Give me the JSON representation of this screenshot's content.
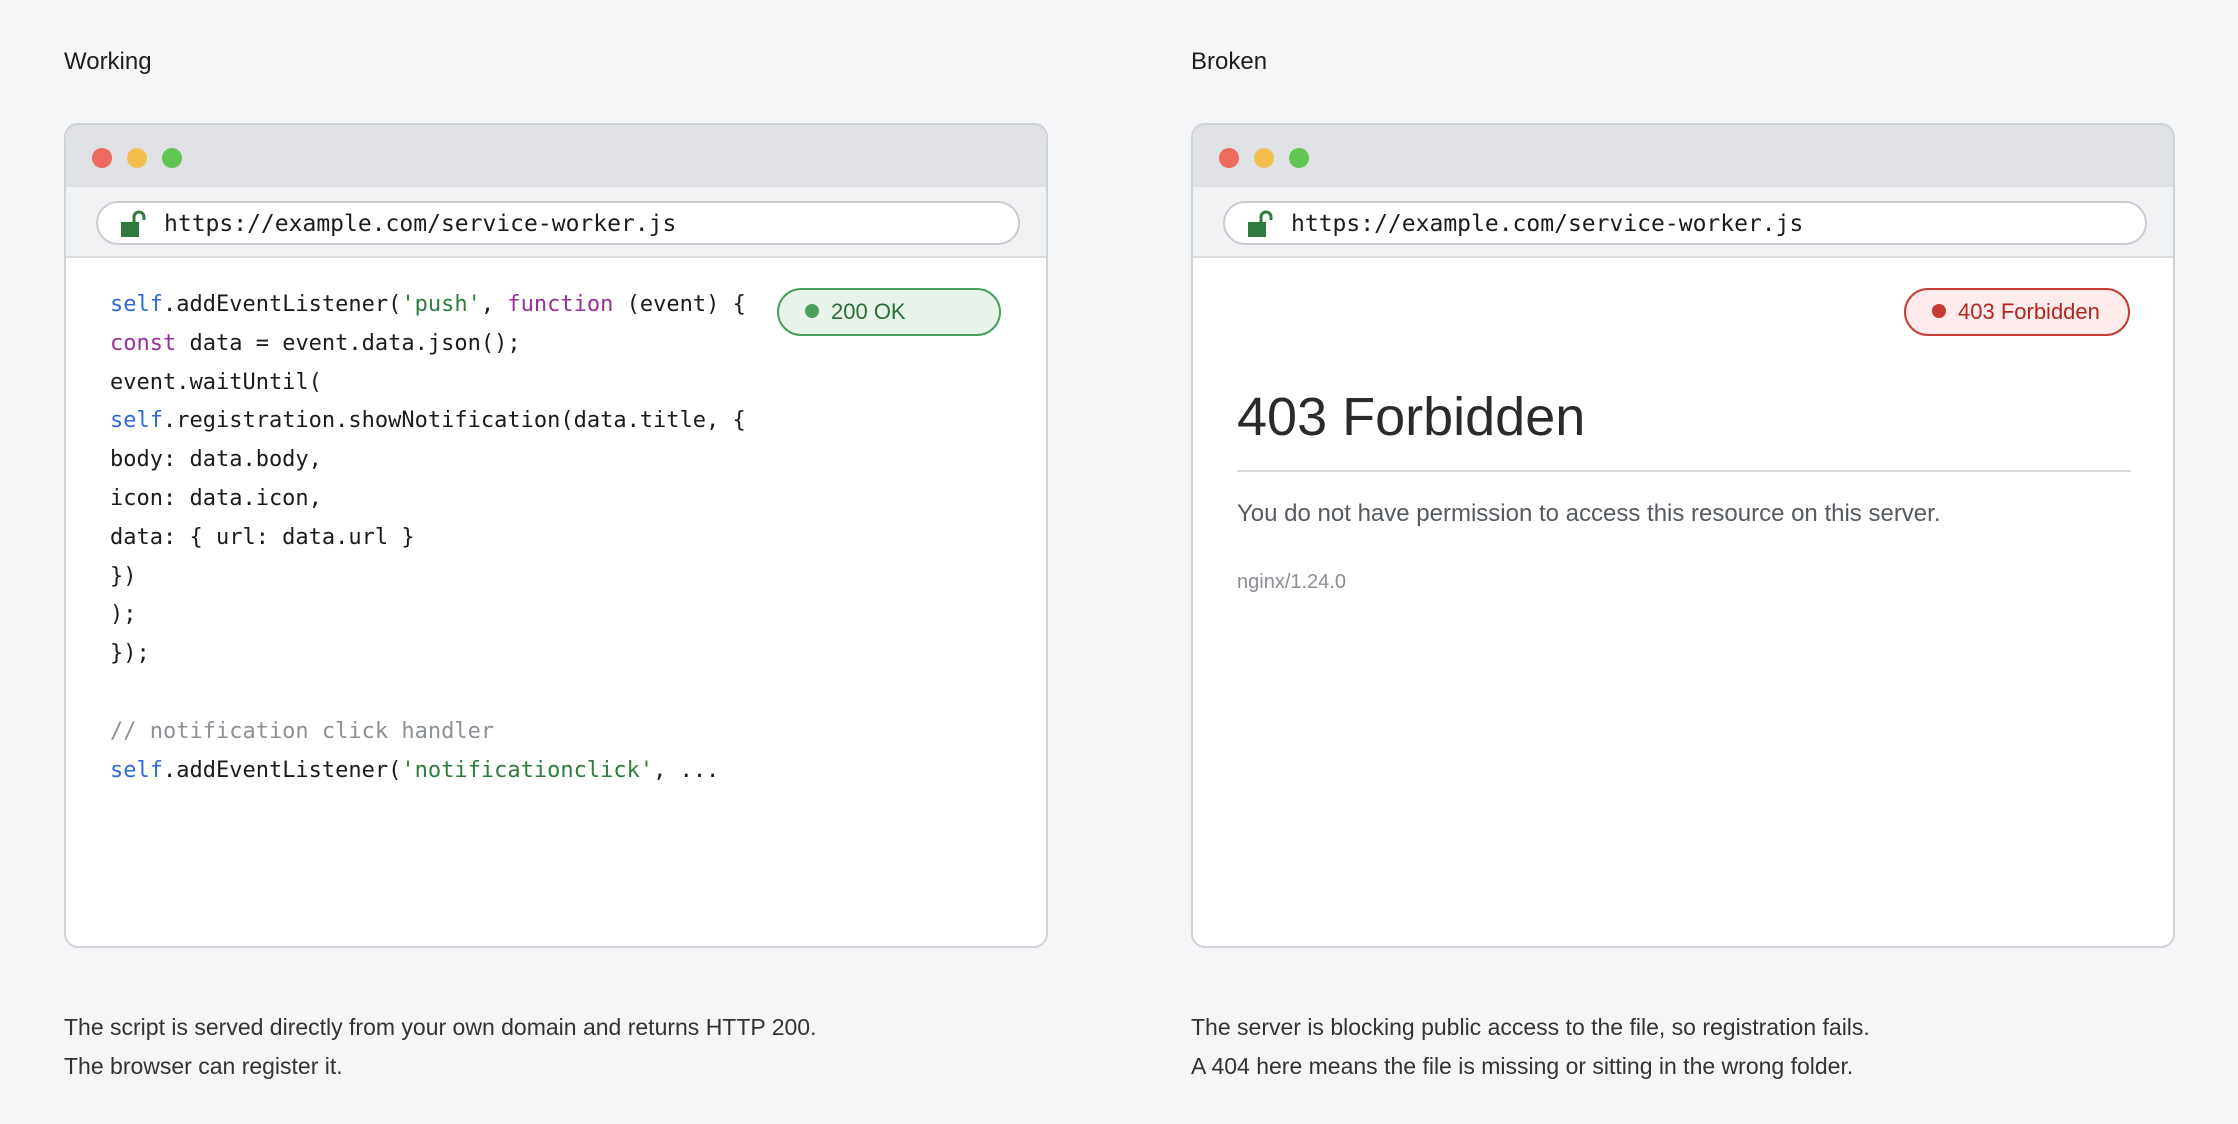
{
  "panels": [
    {
      "title": "Working",
      "url": "https://example.com/service-worker.js",
      "status_badge": "200 OK",
      "code_lines": [
        [
          [
            "self",
            "self"
          ],
          [
            "plain",
            ".addEventListener("
          ],
          [
            "str",
            "'push'"
          ],
          [
            "plain",
            ", "
          ],
          [
            "fn",
            "function"
          ],
          [
            "plain",
            " (event) {"
          ]
        ],
        [
          [
            "fn",
            "const"
          ],
          [
            "plain",
            " data = event.data.json();"
          ]
        ],
        [
          [
            "plain",
            "event.waitUntil("
          ]
        ],
        [
          [
            "self",
            "self"
          ],
          [
            "plain",
            ".registration.showNotification(data.title, {"
          ]
        ],
        [
          [
            "plain",
            "body: data.body,"
          ]
        ],
        [
          [
            "plain",
            "icon: data.icon,"
          ]
        ],
        [
          [
            "plain",
            "data: { url: data.url }"
          ]
        ],
        [
          [
            "plain",
            "})"
          ]
        ],
        [
          [
            "plain",
            ");"
          ]
        ],
        [
          [
            "plain",
            "});"
          ]
        ],
        [],
        [
          [
            "cmt",
            "// notification click handler"
          ]
        ],
        [
          [
            "self",
            "self"
          ],
          [
            "plain",
            ".addEventListener("
          ],
          [
            "str",
            "'notificationclick'"
          ],
          [
            "plain",
            ", ..."
          ]
        ]
      ],
      "caption": [
        "The script is served directly from your own domain and returns HTTP 200.",
        "The browser can register it."
      ]
    },
    {
      "title": "Broken",
      "url": "https://example.com/service-worker.js",
      "status_badge": "403 Forbidden",
      "error_page": {
        "heading": "403 Forbidden",
        "message": "You do not have permission to access this resource on this server.",
        "server": "nginx/1.24.0"
      },
      "caption": [
        "The server is blocking public access to the file, so registration fails.",
        "A 404 here means the file is missing or sitting in the wrong folder."
      ]
    }
  ],
  "icons": {
    "window_controls": [
      "close-dot",
      "minimize-dot",
      "maximize-dot"
    ],
    "address_bar": "unlocked-padlock-icon"
  },
  "colors": {
    "ok_green": "#4aa05b",
    "error_red": "#c93a36",
    "keyword_blue": "#2f6ad8",
    "keyword_purple": "#9a2f9c",
    "string_green": "#2e7d3c",
    "comment_gray": "#8c9197"
  }
}
